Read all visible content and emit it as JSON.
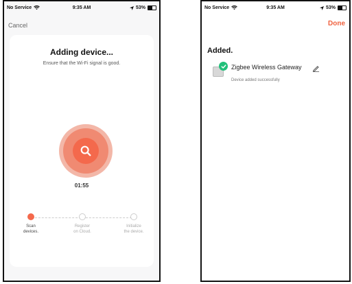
{
  "status_bar": {
    "carrier": "No Service",
    "time": "9:35 AM",
    "battery": "53%"
  },
  "status_bar_right": {
    "carrier": "No Service",
    "time": "9:35 AM",
    "battery": "53%"
  },
  "left_screen": {
    "cancel_label": "Cancel",
    "title": "Adding device...",
    "subtitle": "Ensure that the Wi-Fi signal is good.",
    "timer": "01:55",
    "steps": [
      {
        "label_line1": "Scan",
        "label_line2": "devices.",
        "state": "active"
      },
      {
        "label_line1": "Register",
        "label_line2": "on Cloud.",
        "state": "pending"
      },
      {
        "label_line1": "Initialize",
        "label_line2": "the device.",
        "state": "pending"
      }
    ]
  },
  "right_screen": {
    "done_label": "Done",
    "section_title": "Added.",
    "device": {
      "name": "Zigbee Wireless Gateway",
      "status": "Device added successfully"
    }
  },
  "colors": {
    "accent": "#f4694c",
    "success": "#21c07a"
  },
  "icons": [
    "wifi-icon",
    "location-arrow-icon",
    "battery-icon",
    "search-icon",
    "check-icon",
    "edit-pencil-icon",
    "device-icon"
  ]
}
